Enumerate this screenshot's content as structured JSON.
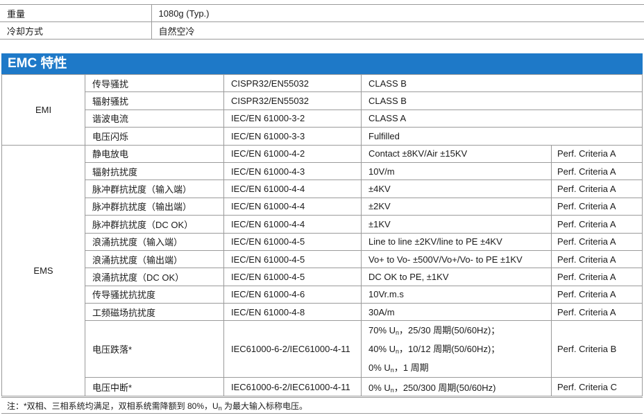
{
  "top_rows": [
    {
      "label": "重量",
      "value": "1080g (Typ.)"
    },
    {
      "label": "冷却方式",
      "value": "自然空冷"
    }
  ],
  "section_title": "EMC 特性",
  "emi": {
    "group": "EMI",
    "rows": [
      {
        "item": "传导骚扰",
        "standard": "CISPR32/EN55032",
        "level": "CLASS B"
      },
      {
        "item": "辐射骚扰",
        "standard": "CISPR32/EN55032",
        "level": "CLASS B"
      },
      {
        "item": "谐波电流",
        "standard": "IEC/EN 61000-3-2",
        "level": "CLASS A"
      },
      {
        "item": "电压闪烁",
        "standard": "IEC/EN 61000-3-3",
        "level": "Fulfilled"
      }
    ]
  },
  "ems": {
    "group": "EMS",
    "rows": [
      {
        "item": "静电放电",
        "standard": "IEC/EN 61000-4-2",
        "level": "Contact ±8KV/Air ±15KV",
        "criteria": "Perf. Criteria A"
      },
      {
        "item": "辐射抗扰度",
        "standard": "IEC/EN 61000-4-3",
        "level": "10V/m",
        "criteria": "Perf. Criteria A"
      },
      {
        "item": "脉冲群抗扰度（输入端）",
        "standard": "IEC/EN 61000-4-4",
        "level": "±4KV",
        "criteria": "Perf. Criteria A"
      },
      {
        "item": "脉冲群抗扰度（输出端）",
        "standard": "IEC/EN 61000-4-4",
        "level": "±2KV",
        "criteria": "Perf. Criteria A"
      },
      {
        "item": "脉冲群抗扰度（DC OK）",
        "standard": "IEC/EN 61000-4-4",
        "level": "±1KV",
        "criteria": "Perf. Criteria A"
      },
      {
        "item": "浪涌抗扰度（输入端）",
        "standard": "IEC/EN 61000-4-5",
        "level": "Line to line ±2KV/line to PE ±4KV",
        "criteria": "Perf. Criteria A"
      },
      {
        "item": "浪涌抗扰度（输出端）",
        "standard": "IEC/EN 61000-4-5",
        "level": "Vo+ to Vo- ±500V/Vo+/Vo- to PE ±1KV",
        "criteria": "Perf. Criteria A"
      },
      {
        "item": "浪涌抗扰度（DC OK）",
        "standard": "IEC/EN 61000-4-5",
        "level": "DC OK to PE, ±1KV",
        "criteria": "Perf. Criteria A"
      },
      {
        "item": "传导骚扰抗扰度",
        "standard": "IEC/EN 61000-4-6",
        "level": "10Vr.m.s",
        "criteria": "Perf. Criteria A"
      },
      {
        "item": "工频磁场抗扰度",
        "standard": "IEC/EN 61000-4-8",
        "level": "30A/m",
        "criteria": "Perf. Criteria A"
      }
    ],
    "dip": {
      "item": "电压跌落*",
      "standard": "IEC61000-6-2/IEC61000-4-11",
      "lines": [
        {
          "pre": "70% U",
          "sub": "n",
          "post": "，25/30 周期(50/60Hz)；"
        },
        {
          "pre": "40% U",
          "sub": "n",
          "post": "，10/12 周期(50/60Hz)；"
        },
        {
          "pre": "0% U",
          "sub": "n",
          "post": "，1 周期"
        }
      ],
      "criteria": "Perf. Criteria B"
    },
    "interrupt": {
      "item": "电压中断*",
      "standard": "IEC61000-6-2/IEC61000-4-11",
      "line": {
        "pre": "0% U",
        "sub": "n",
        "post": "，250/300 周期(50/60Hz)"
      },
      "criteria": "Perf. Criteria C"
    }
  },
  "note": {
    "pre": "注：*双相、三相系统均满足，双相系统需降额到 80%，U",
    "sub": "n",
    "post": " 为最大输入标称电压。"
  }
}
